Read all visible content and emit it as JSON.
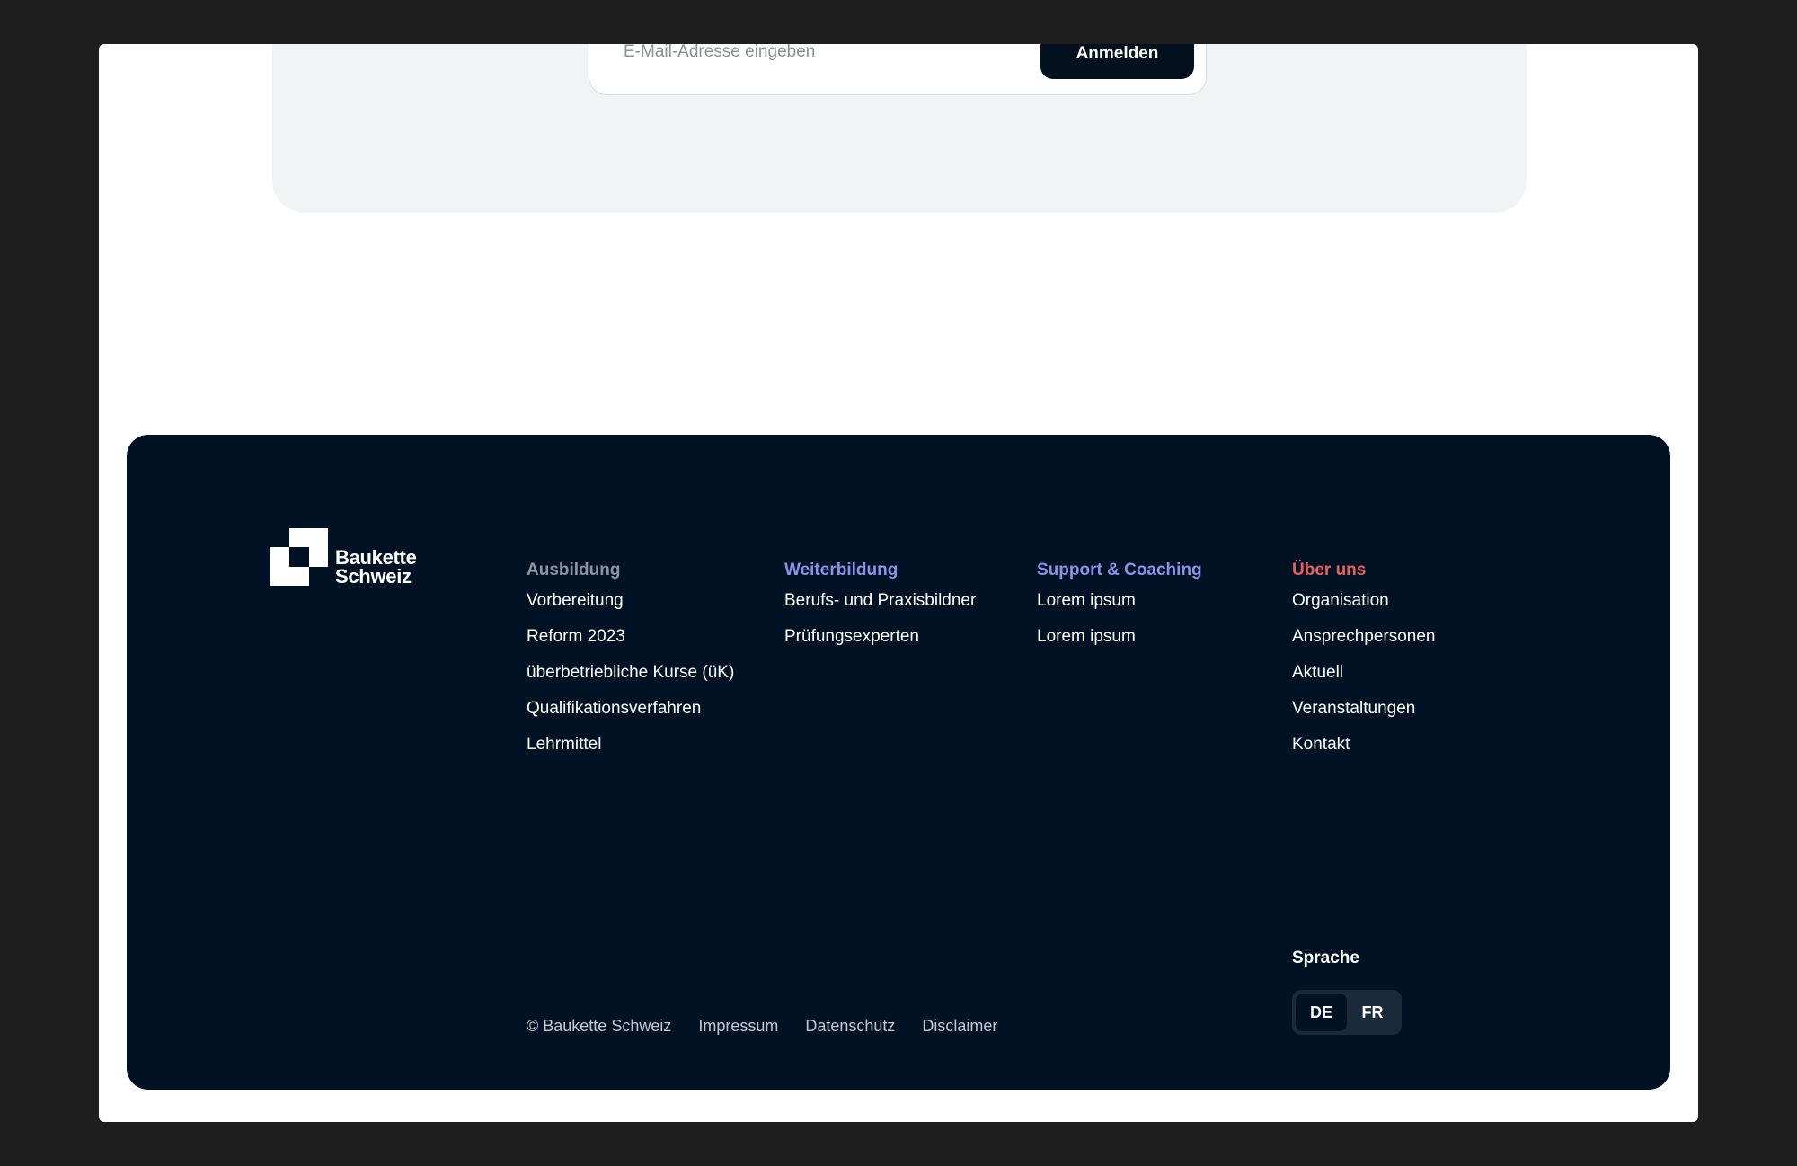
{
  "newsletter": {
    "email_placeholder": "E-Mail-Adresse eingeben",
    "submit_label": "Anmelden"
  },
  "footer": {
    "logo": {
      "line1": "Baukette",
      "line2": "Schweiz",
      "icon": "baukette-logo-mark"
    },
    "columns": [
      {
        "title": "Ausbildung",
        "title_color": "#8c96a3",
        "links": [
          "Vorbereitung",
          "Reform 2023",
          "überbetriebliche Kurse (üK)",
          "Qualifikationsverfahren",
          "Lehrmittel"
        ]
      },
      {
        "title": "Weiterbildung",
        "title_color": "#8d92e8",
        "links": [
          "Berufs- und Praxisbildner",
          "Prüfungsexperten"
        ]
      },
      {
        "title": "Support & Coaching",
        "title_color": "#8d92e8",
        "links": [
          "Lorem ipsum",
          "Lorem ipsum"
        ]
      },
      {
        "title": "Über uns",
        "title_color": "#e8625c",
        "links": [
          "Organisation",
          "Ansprechpersonen",
          "Aktuell",
          "Veranstaltungen",
          "Kontakt"
        ]
      }
    ],
    "legal": {
      "copyright": "© Baukette Schweiz",
      "links": [
        "Impressum",
        "Datenschutz",
        "Disclaimer"
      ]
    },
    "language": {
      "label": "Sprache",
      "options": [
        "DE",
        "FR"
      ],
      "selected": "DE"
    }
  },
  "colors": {
    "background": "#1e1e1e",
    "footer_bg": "#021225",
    "newsletter_bg": "#f2f3f4",
    "button_bg": "#03111f"
  }
}
